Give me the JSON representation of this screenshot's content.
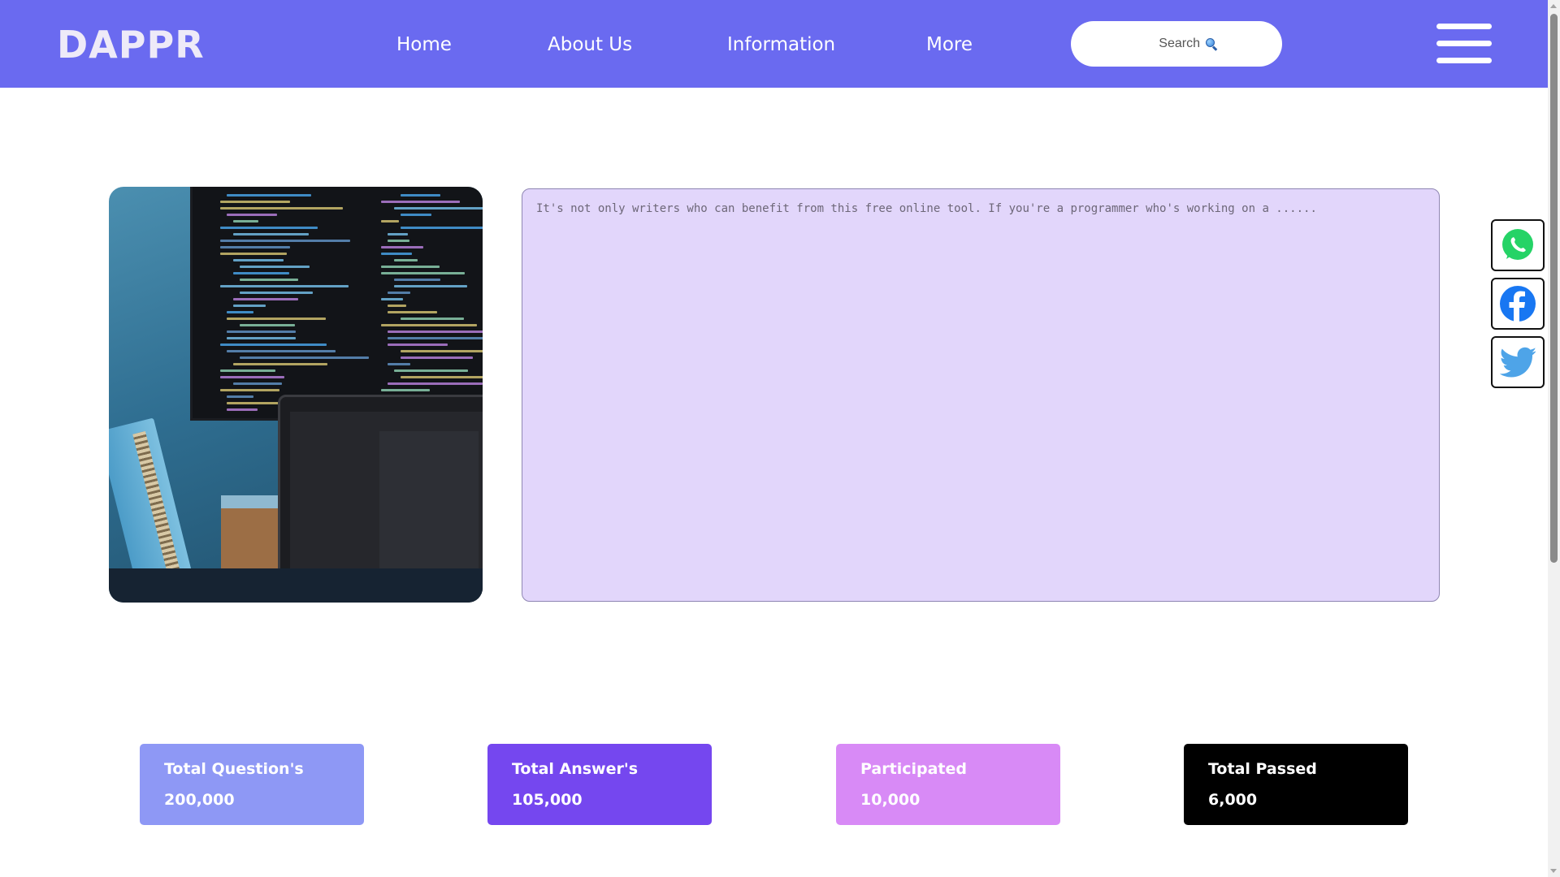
{
  "brand": {
    "logo": "DAPPR",
    "color": "#6a6af0"
  },
  "nav": {
    "items": [
      {
        "label": "Home"
      },
      {
        "label": "About Us"
      },
      {
        "label": "Information"
      },
      {
        "label": "More"
      }
    ]
  },
  "search": {
    "placeholder": "Search",
    "icon": "magnifier-icon"
  },
  "menu": {
    "icon": "hamburger-menu-icon"
  },
  "hero": {
    "image": "laptop-and-monitor-code-photo"
  },
  "editor": {
    "placeholder": "It's not only writers who can benefit from this free online tool. If you're a programmer who's working on a ......",
    "background": "#e2d6fb"
  },
  "social": [
    {
      "name": "whatsapp",
      "icon": "whatsapp-icon",
      "color": "#25d366"
    },
    {
      "name": "facebook",
      "icon": "facebook-icon",
      "color": "#1877f2"
    },
    {
      "name": "twitter",
      "icon": "twitter-icon",
      "color": "#4ea4e8"
    }
  ],
  "stats": [
    {
      "label": "Total Question's",
      "value": "200,000",
      "color": "#8e98f5"
    },
    {
      "label": "Total Answer's",
      "value": "105,000",
      "color": "#7547ef"
    },
    {
      "label": "Participated",
      "value": "10,000",
      "color": "#d88af6"
    },
    {
      "label": "Total Passed",
      "value": "6,000",
      "color": "#000000"
    }
  ]
}
